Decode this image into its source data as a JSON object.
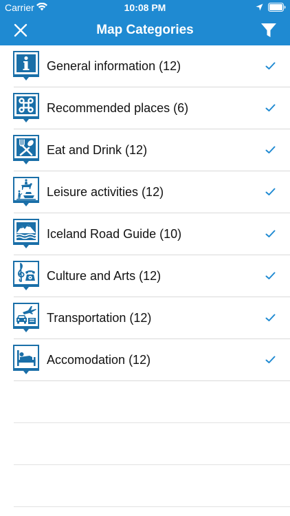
{
  "status_bar": {
    "carrier": "Carrier",
    "time": "10:08 PM"
  },
  "nav": {
    "title": "Map Categories",
    "close_icon": "close-x-icon",
    "filter_icon": "filter-funnel-icon"
  },
  "colors": {
    "header_bg": "#1f8ad2",
    "icon_blue": "#1a6fa8",
    "check_blue": "#1f8ad2"
  },
  "categories": [
    {
      "label": "General information (12)",
      "icon": "info-icon",
      "checked": true
    },
    {
      "label": "Recommended places (6)",
      "icon": "command-symbol-icon",
      "checked": true
    },
    {
      "label": "Eat and Drink (12)",
      "icon": "fork-spoon-icon",
      "checked": true
    },
    {
      "label": "Leisure activities (12)",
      "icon": "horse-rider-icon",
      "checked": true
    },
    {
      "label": "Iceland Road Guide (10)",
      "icon": "mountains-icon",
      "checked": true
    },
    {
      "label": "Culture and Arts (12)",
      "icon": "treble-clef-icon",
      "checked": true
    },
    {
      "label": "Transportation (12)",
      "icon": "plane-car-icon",
      "checked": true
    },
    {
      "label": "Accomodation (12)",
      "icon": "bed-icon",
      "checked": true
    }
  ]
}
